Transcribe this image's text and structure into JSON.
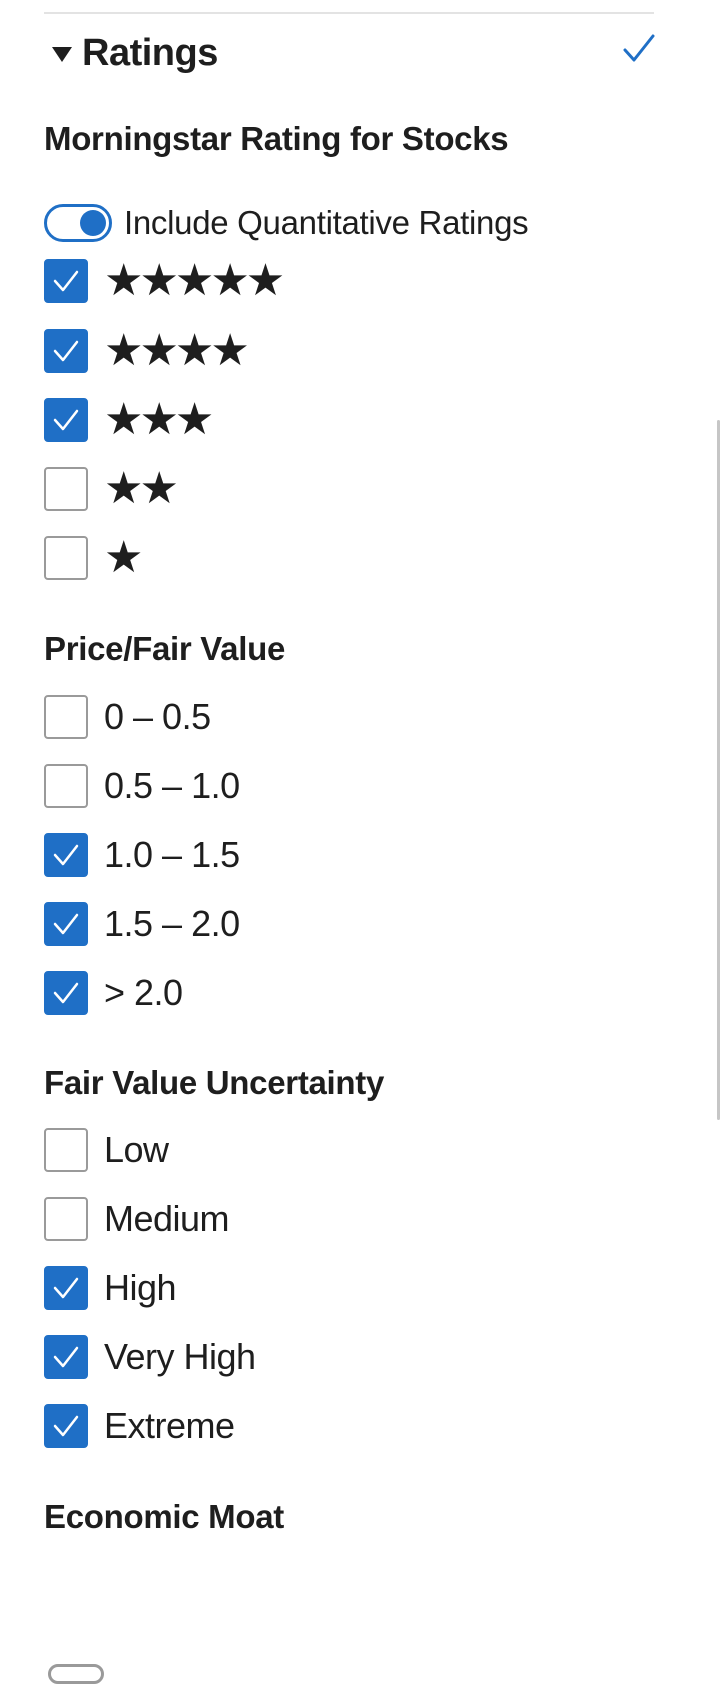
{
  "section": {
    "title": "Ratings",
    "check_icon": "check-icon"
  },
  "morningstar_rating": {
    "title": "Morningstar Rating for Stocks",
    "toggle": {
      "label": "Include Quantitative Ratings",
      "on": true
    },
    "options": [
      {
        "stars": "★★★★★",
        "checked": true
      },
      {
        "stars": "★★★★",
        "checked": true
      },
      {
        "stars": "★★★",
        "checked": true
      },
      {
        "stars": "★★",
        "checked": false
      },
      {
        "stars": "★",
        "checked": false
      }
    ]
  },
  "price_fair_value": {
    "title": "Price/Fair Value",
    "options": [
      {
        "label": "0 – 0.5",
        "checked": false
      },
      {
        "label": "0.5 – 1.0",
        "checked": false
      },
      {
        "label": "1.0 – 1.5",
        "checked": true
      },
      {
        "label": "1.5 – 2.0",
        "checked": true
      },
      {
        "label": "> 2.0",
        "checked": true
      }
    ]
  },
  "fair_value_uncertainty": {
    "title": "Fair Value Uncertainty",
    "options": [
      {
        "label": "Low",
        "checked": false
      },
      {
        "label": "Medium",
        "checked": false
      },
      {
        "label": "High",
        "checked": true
      },
      {
        "label": "Very High",
        "checked": true
      },
      {
        "label": "Extreme",
        "checked": true
      }
    ]
  },
  "economic_moat": {
    "title": "Economic Moat"
  },
  "colors": {
    "accent": "#1f6fc6",
    "text": "#1e1e1e",
    "unchecked_border": "#9a9a9a"
  }
}
